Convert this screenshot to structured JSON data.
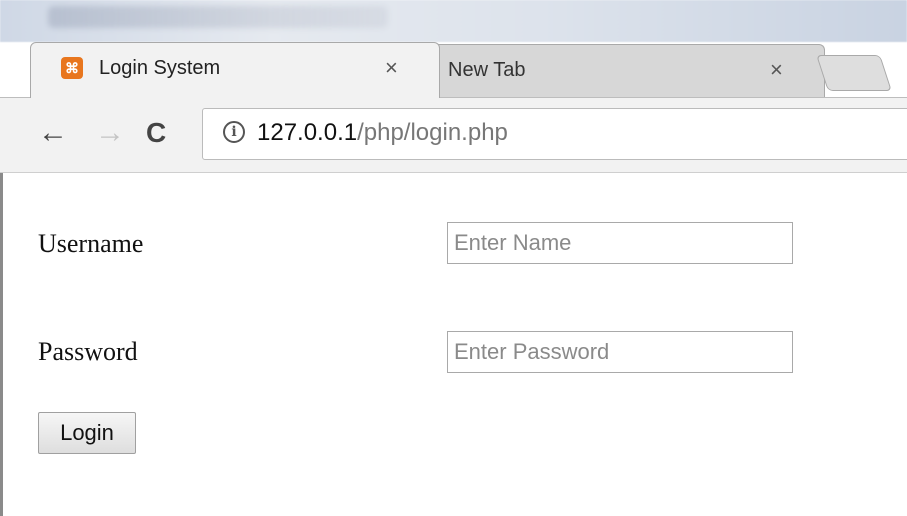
{
  "browser": {
    "tabs": [
      {
        "title": "Login System",
        "close": "×",
        "favicon": "xampp-icon",
        "favicon_color": "#e8761e",
        "active": true
      },
      {
        "title": "New Tab",
        "close": "×",
        "active": false
      }
    ],
    "nav": {
      "back": "←",
      "forward": "→",
      "reload": "C"
    },
    "address": {
      "info": "i",
      "host": "127.0.0.1",
      "path": "/php/login.php"
    }
  },
  "form": {
    "username_label": "Username",
    "username_placeholder": "Enter Name",
    "password_label": "Password",
    "password_placeholder": "Enter Password",
    "login_button": "Login"
  }
}
